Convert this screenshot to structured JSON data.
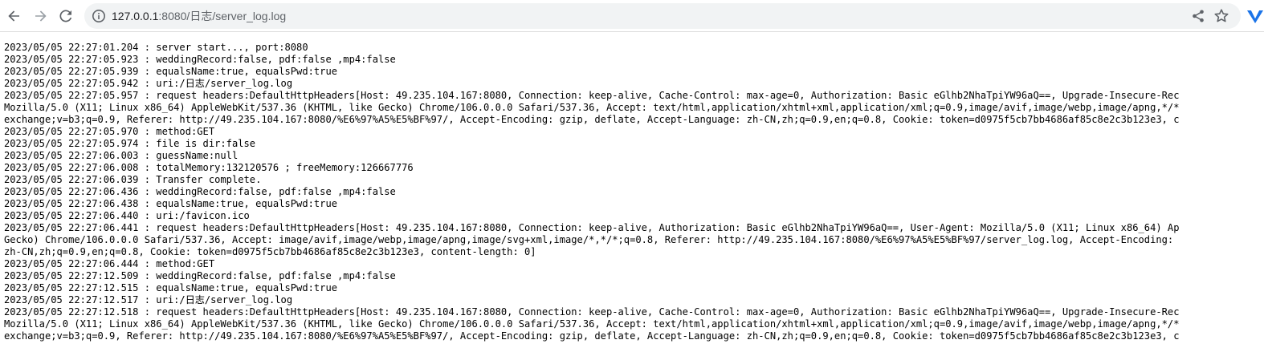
{
  "browser": {
    "url_host": "127.0.0.1",
    "url_rest": ":8080/日志/server_log.log",
    "icons": {
      "back": "arrow-left-icon",
      "forward": "arrow-right-icon",
      "reload": "reload-icon",
      "site_info": "info-icon",
      "share": "share-icon",
      "bookmark": "star-icon",
      "extension": "extension-icon"
    },
    "colors": {
      "omnibox_bg": "#f1f3f4",
      "icon": "#5f6368",
      "icon_disabled": "#9aa0a6",
      "extension": "#1a73e8"
    }
  },
  "log": {
    "lines": [
      "2023/05/05 22:27:01.204 : server start..., port:8080",
      "2023/05/05 22:27:05.923 : weddingRecord:false, pdf:false ,mp4:false",
      "2023/05/05 22:27:05.939 : equalsName:true, equalsPwd:true",
      "2023/05/05 22:27:05.942 : uri:/日志/server_log.log",
      "2023/05/05 22:27:05.957 : request headers:DefaultHttpHeaders[Host: 49.235.104.167:8080, Connection: keep-alive, Cache-Control: max-age=0, Authorization: Basic eGlhb2NhaTpiYW96aQ==, Upgrade-Insecure-Rec",
      "Mozilla/5.0 (X11; Linux x86_64) AppleWebKit/537.36 (KHTML, like Gecko) Chrome/106.0.0.0 Safari/537.36, Accept: text/html,application/xhtml+xml,application/xml;q=0.9,image/avif,image/webp,image/apng,*/*",
      "exchange;v=b3;q=0.9, Referer: http://49.235.104.167:8080/%E6%97%A5%E5%BF%97/, Accept-Encoding: gzip, deflate, Accept-Language: zh-CN,zh;q=0.9,en;q=0.8, Cookie: token=d0975f5cb7bb4686af85c8e2c3b123e3, c",
      "2023/05/05 22:27:05.970 : method:GET",
      "2023/05/05 22:27:05.974 : file is dir:false",
      "2023/05/05 22:27:06.003 : guessName:null",
      "2023/05/05 22:27:06.008 : totalMemory:132120576 ; freeMemory:126667776",
      "2023/05/05 22:27:06.039 : Transfer complete.",
      "2023/05/05 22:27:06.436 : weddingRecord:false, pdf:false ,mp4:false",
      "2023/05/05 22:27:06.438 : equalsName:true, equalsPwd:true",
      "2023/05/05 22:27:06.440 : uri:/favicon.ico",
      "2023/05/05 22:27:06.441 : request headers:DefaultHttpHeaders[Host: 49.235.104.167:8080, Connection: keep-alive, Authorization: Basic eGlhb2NhaTpiYW96aQ==, User-Agent: Mozilla/5.0 (X11; Linux x86_64) Ap",
      "Gecko) Chrome/106.0.0.0 Safari/537.36, Accept: image/avif,image/webp,image/apng,image/svg+xml,image/*,*/*;q=0.8, Referer: http://49.235.104.167:8080/%E6%97%A5%E5%BF%97/server_log.log, Accept-Encoding: ",
      "zh-CN,zh;q=0.9,en;q=0.8, Cookie: token=d0975f5cb7bb4686af85c8e2c3b123e3, content-length: 0]",
      "2023/05/05 22:27:06.444 : method:GET",
      "2023/05/05 22:27:12.509 : weddingRecord:false, pdf:false ,mp4:false",
      "2023/05/05 22:27:12.515 : equalsName:true, equalsPwd:true",
      "2023/05/05 22:27:12.517 : uri:/日志/server_log.log",
      "2023/05/05 22:27:12.518 : request headers:DefaultHttpHeaders[Host: 49.235.104.167:8080, Connection: keep-alive, Cache-Control: max-age=0, Authorization: Basic eGlhb2NhaTpiYW96aQ==, Upgrade-Insecure-Rec",
      "Mozilla/5.0 (X11; Linux x86_64) AppleWebKit/537.36 (KHTML, like Gecko) Chrome/106.0.0.0 Safari/537.36, Accept: text/html,application/xhtml+xml,application/xml;q=0.9,image/avif,image/webp,image/apng,*/*",
      "exchange;v=b3;q=0.9, Referer: http://49.235.104.167:8080/%E6%97%A5%E5%BF%97/, Accept-Encoding: gzip, deflate, Accept-Language: zh-CN,zh;q=0.9,en;q=0.8, Cookie: token=d0975f5cb7bb4686af85c8e2c3b123e3, c"
    ]
  }
}
